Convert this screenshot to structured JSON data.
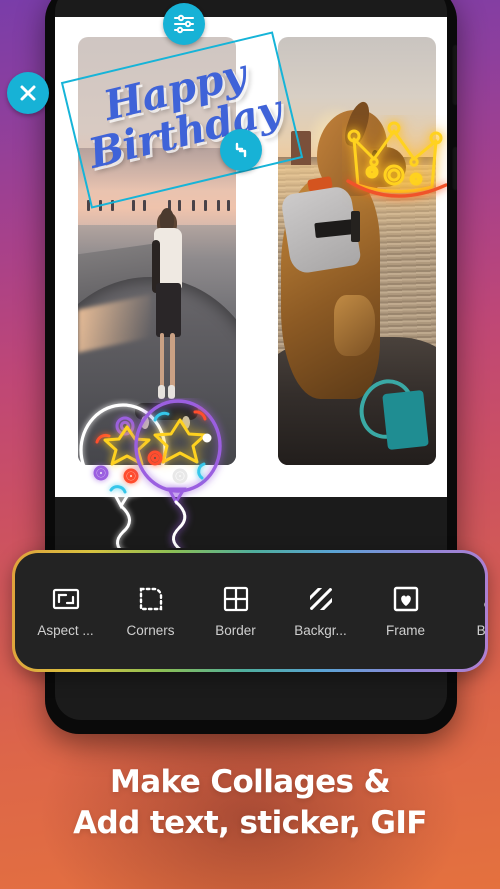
{
  "app": {
    "promo_headline_line1": "Make Collages &",
    "promo_headline_line2": "Add text, sticker, GIF"
  },
  "canvas": {
    "text_sticker": {
      "line1": "Happy",
      "line2": "Birthday",
      "color": "#3f63d8",
      "selection_color": "#16b4d8",
      "rotation_deg": -13.5
    },
    "handles": [
      {
        "name": "edit-handle",
        "icon": "sliders-icon"
      },
      {
        "name": "delete-handle",
        "icon": "close-icon"
      },
      {
        "name": "rotate-resize-handle",
        "icon": "rotate-icon"
      }
    ],
    "photos": [
      {
        "name": "photo-left",
        "description": "Skateboarder at skatepark at sunset"
      },
      {
        "name": "photo-right",
        "description": "Dog in life vest on a boat at sunset"
      }
    ],
    "stickers": [
      {
        "name": "crown-sticker",
        "style": "neon",
        "color": "#ffd21f"
      },
      {
        "name": "balloon-sticker-white",
        "style": "neon",
        "color": "#ffffff"
      },
      {
        "name": "balloon-sticker-purple",
        "style": "neon",
        "color": "#9b5fe0"
      }
    ]
  },
  "toolbar": {
    "items": [
      {
        "label": "Aspect ...",
        "icon": "aspect-ratio-icon"
      },
      {
        "label": "Corners",
        "icon": "rounded-corners-icon"
      },
      {
        "label": "Border",
        "icon": "grid-border-icon"
      },
      {
        "label": "Backgr...",
        "icon": "diagonal-stripes-icon"
      },
      {
        "label": "Frame",
        "icon": "heart-frame-icon"
      },
      {
        "label": "Brus",
        "icon": "paintbrush-icon"
      }
    ],
    "border_gradient": [
      "#e0a13c",
      "#d8c23f",
      "#8bbf55",
      "#4fae9e",
      "#5aa3d4",
      "#8f86d8",
      "#b07fd0"
    ],
    "background": "#232323"
  },
  "ghost_toolbar": {
    "items": [
      "Aspect ...",
      "Corners",
      "Border",
      "Backgro...",
      "Frame",
      "Br"
    ]
  },
  "theme": {
    "bg_top": "#7a3da9",
    "bg_bottom": "#e4713e",
    "accent": "#17b2d6"
  }
}
